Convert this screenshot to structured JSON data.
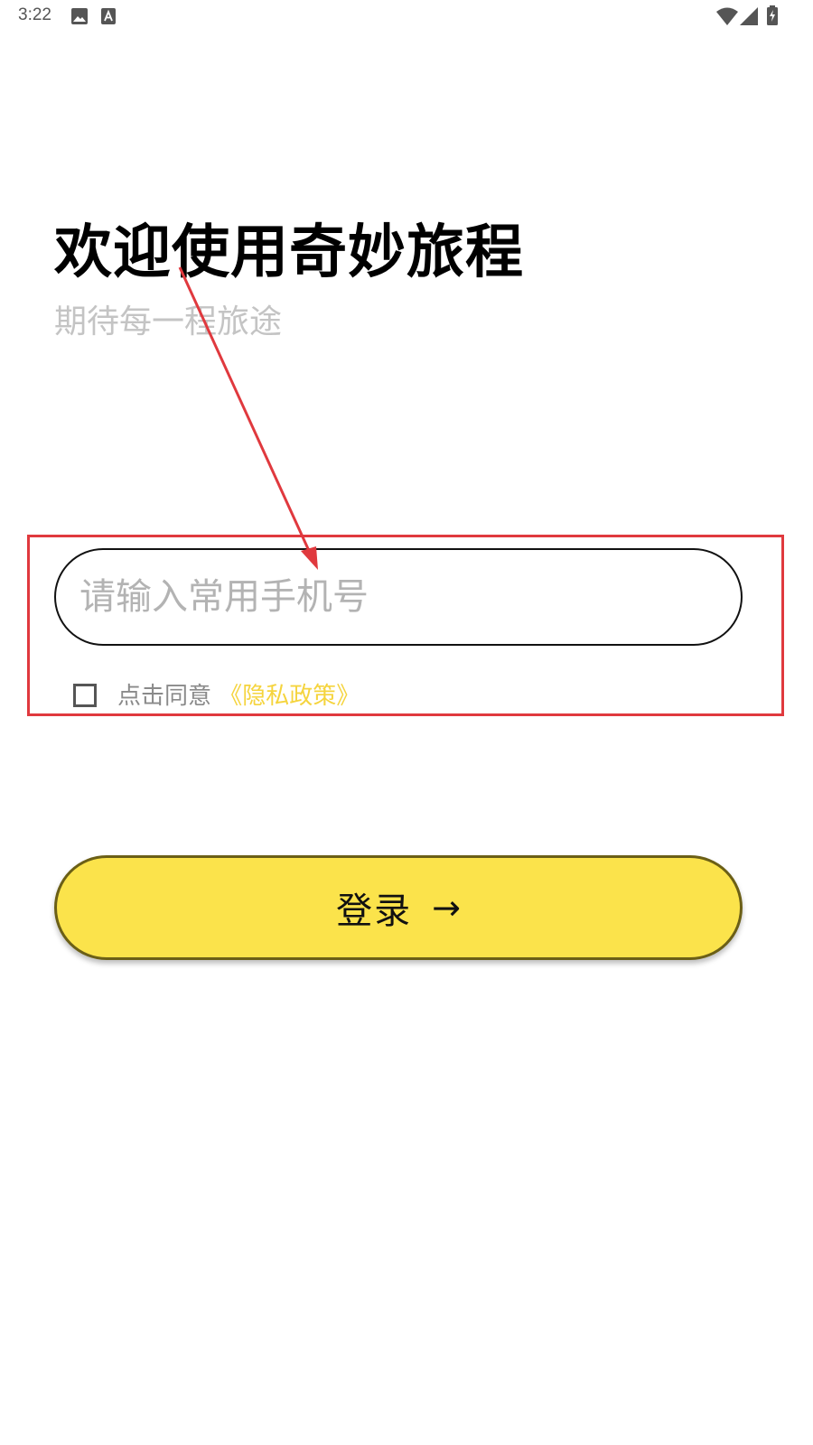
{
  "status_bar": {
    "time": "3:22",
    "icons": [
      "image-icon",
      "text-a-icon",
      "wifi-icon",
      "signal-icon",
      "battery-charging-icon"
    ]
  },
  "header": {
    "title": "欢迎使用奇妙旅程",
    "subtitle": "期待每一程旅途"
  },
  "login_form": {
    "phone_placeholder": "请输入常用手机号",
    "phone_value": "",
    "agree_checked": false,
    "agree_text": "点击同意",
    "privacy_link": "《隐私政策》",
    "login_label": "登录",
    "login_arrow": "→"
  },
  "colors": {
    "accent_yellow": "#fbe34b",
    "link_yellow": "#f5d43e",
    "annotation_red": "#e0393e",
    "subtitle_gray": "#c4c4c4"
  }
}
